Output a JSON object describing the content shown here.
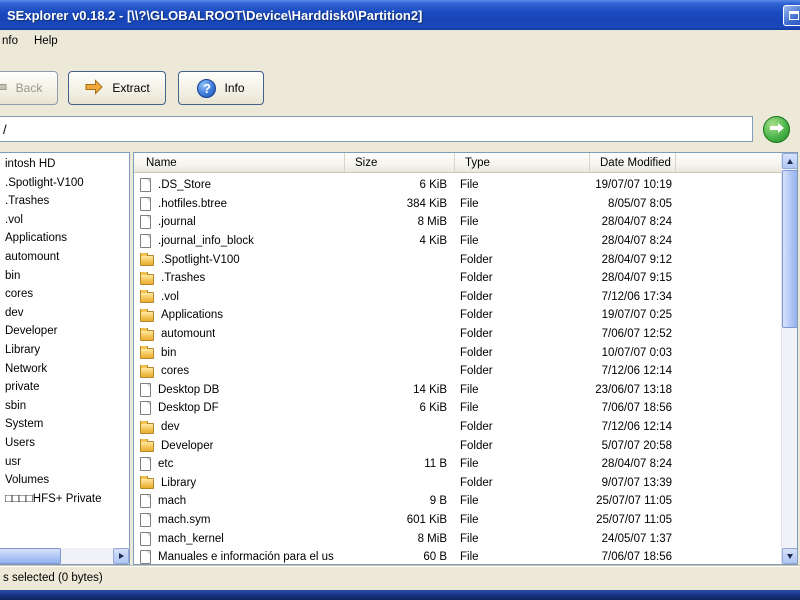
{
  "window": {
    "title": "SExplorer v0.18.2 - [\\\\?\\GLOBALROOT\\Device\\Harddisk0\\Partition2]"
  },
  "menu": {
    "items": [
      "nfo",
      "Help"
    ]
  },
  "toolbar": {
    "back_label": "Back",
    "extract_label": "Extract",
    "info_label": "Info"
  },
  "icons": {
    "question_mark": "?"
  },
  "address": {
    "path_value": "/"
  },
  "tree": {
    "items": [
      "intosh HD",
      ".Spotlight-V100",
      ".Trashes",
      ".vol",
      "Applications",
      "automount",
      "bin",
      "cores",
      "dev",
      "Developer",
      "Library",
      "Network",
      "private",
      "sbin",
      "System",
      "Users",
      "usr",
      "Volumes",
      "□□□□HFS+ Private"
    ]
  },
  "filelist": {
    "columns": [
      "Name",
      "Size",
      "Type",
      "Date Modified"
    ],
    "rows": [
      {
        "name": ".DS_Store",
        "size": "6 KiB",
        "type": "File",
        "date": "19/07/07 10:19"
      },
      {
        "name": ".hotfiles.btree",
        "size": "384 KiB",
        "type": "File",
        "date": "8/05/07 8:05"
      },
      {
        "name": ".journal",
        "size": "8 MiB",
        "type": "File",
        "date": "28/04/07 8:24"
      },
      {
        "name": ".journal_info_block",
        "size": "4 KiB",
        "type": "File",
        "date": "28/04/07 8:24"
      },
      {
        "name": ".Spotlight-V100",
        "size": "",
        "type": "Folder",
        "date": "28/04/07 9:12"
      },
      {
        "name": ".Trashes",
        "size": "",
        "type": "Folder",
        "date": "28/04/07 9:15"
      },
      {
        "name": ".vol",
        "size": "",
        "type": "Folder",
        "date": "7/12/06 17:34"
      },
      {
        "name": "Applications",
        "size": "",
        "type": "Folder",
        "date": "19/07/07 0:25"
      },
      {
        "name": "automount",
        "size": "",
        "type": "Folder",
        "date": "7/06/07 12:52"
      },
      {
        "name": "bin",
        "size": "",
        "type": "Folder",
        "date": "10/07/07 0:03"
      },
      {
        "name": "cores",
        "size": "",
        "type": "Folder",
        "date": "7/12/06 12:14"
      },
      {
        "name": "Desktop DB",
        "size": "14 KiB",
        "type": "File",
        "date": "23/06/07 13:18"
      },
      {
        "name": "Desktop DF",
        "size": "6 KiB",
        "type": "File",
        "date": "7/06/07 18:56"
      },
      {
        "name": "dev",
        "size": "",
        "type": "Folder",
        "date": "7/12/06 12:14"
      },
      {
        "name": "Developer",
        "size": "",
        "type": "Folder",
        "date": "5/07/07 20:58"
      },
      {
        "name": "etc",
        "size": "11 B",
        "type": "File",
        "date": "28/04/07 8:24"
      },
      {
        "name": "Library",
        "size": "",
        "type": "Folder",
        "date": "9/07/07 13:39"
      },
      {
        "name": "mach",
        "size": "9 B",
        "type": "File",
        "date": "25/07/07 11:05"
      },
      {
        "name": "mach.sym",
        "size": "601 KiB",
        "type": "File",
        "date": "25/07/07 11:05"
      },
      {
        "name": "mach_kernel",
        "size": "8 MiB",
        "type": "File",
        "date": "24/05/07 1:37"
      },
      {
        "name": "Manuales e información para el us",
        "size": "60 B",
        "type": "File",
        "date": "7/06/07 18:56"
      }
    ]
  },
  "statusbar": {
    "text": "s selected (0 bytes)"
  },
  "colors": {
    "titlebar_blue": "#1C4BC0",
    "window_gray": "#ECE9D8",
    "go_green": "#2F9E2F",
    "folder_yellow": "#F3C354",
    "bottom_strip": "#16307E"
  }
}
